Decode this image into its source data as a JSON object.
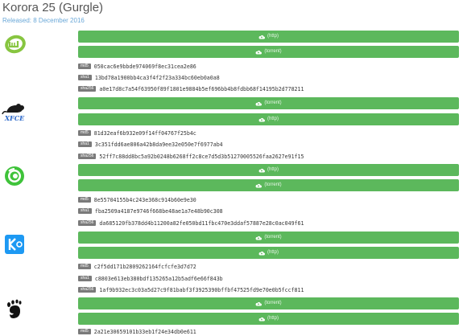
{
  "header": {
    "title": "Korora 25 (Gurgle)",
    "released": "Released: 8 December 2016"
  },
  "icons": {
    "cloud": "cloud-download-icon",
    "mate": "linux-mint-mate-logo",
    "xfce": "xfce-mouse-logo",
    "cinnamon": "cinnamon-logo",
    "kde": "kde-logo",
    "gnome": "gnome-foot-logo"
  },
  "colors": {
    "button": "#5cb85c",
    "hash_label": "#7a7a7a",
    "released": "#6aa8d8"
  },
  "hash_labels": {
    "md5": "md5",
    "sha1": "sha1",
    "sha256": "sha256"
  },
  "editions": [
    {
      "name": "MATE",
      "buttons": [
        "(http)",
        "(torrent)"
      ],
      "md5": "050cac6e9bbde974069f8ec31cea2e86",
      "sha1": "13bd78a1900bb4ca3f4f2f23a334bc60eb0a0a8",
      "sha256": "a0e17d8c7a54f63950f89f1801e9884b5ef696bb4b8fdbb68f14195b2d778211"
    },
    {
      "name": "Xfce",
      "buttons": [
        "(torrent)",
        "(http)"
      ],
      "md5": "81d32eaf6b932e09f14ff04767f25b4c",
      "sha1": "3c351fdd6ae806a42b8da9ee32e050e7f6977ab4",
      "sha256": "52ff7c88dd8bc5a92b0248b6268ff2c8ce7d5d3b51270005526faa2627e91f15"
    },
    {
      "name": "Cinnamon",
      "buttons": [
        "(http)",
        "(torrent)"
      ],
      "md5": "8e55704155b4c243e368c914b60e9e30",
      "sha1": "fba2509a4187e9746f668be48ae1a7e48b90c308",
      "sha256": "da685120fb378dd4b11200a82fe050bd11fbc470e3ddaf57887e28c0ac049f61"
    },
    {
      "name": "KDE",
      "buttons": [
        "(torrent)",
        "(http)"
      ],
      "md5": "c2f5dd171b2809262164fcfcfe3d7d72",
      "sha1": "c8803e613eb380bdf135265a12b5adf6e66f843b",
      "sha256": "1af9b932ec3c03a5d27c9f81babf3f3925390bffbf47525fd9e70e0b5fccf811"
    },
    {
      "name": "GNOME",
      "buttons": [
        "(torrent)",
        "(http)"
      ],
      "md5": "2a21e30659101b33eb1f24e34db0e611"
    }
  ]
}
